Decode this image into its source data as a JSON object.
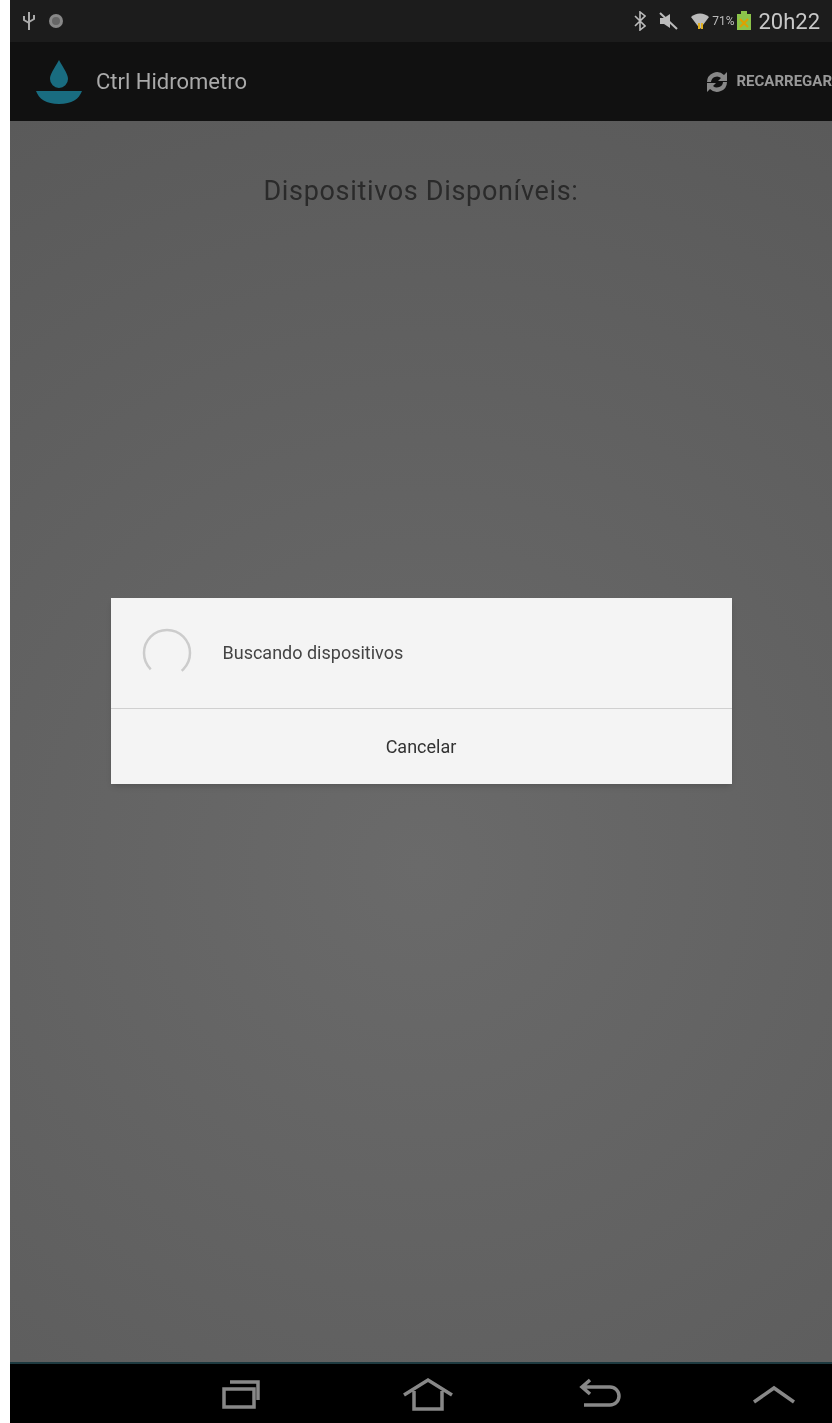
{
  "status_bar": {
    "battery_percent": "71%",
    "time": "20h22"
  },
  "action_bar": {
    "title": "Ctrl Hidrometro",
    "action": "RECARREGAR"
  },
  "heading": "Dispositivos Disponíveis:",
  "dialog": {
    "message": "Buscando dispositivos",
    "button": "Cancelar"
  }
}
